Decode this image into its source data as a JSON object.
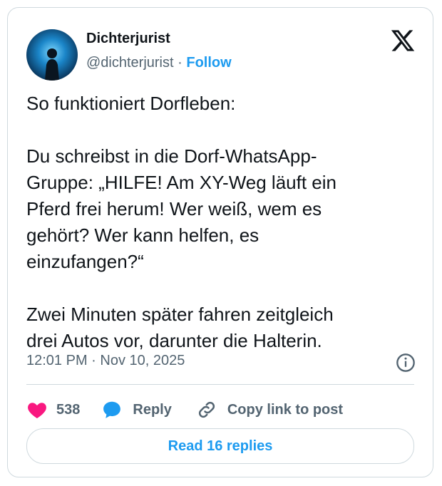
{
  "author": {
    "display_name": "Dichterjurist",
    "handle": "@dichterjurist",
    "separator": "·",
    "follow_label": "Follow"
  },
  "post": {
    "text": "So funktioniert Dorfleben:\n\nDu schreibst in die Dorf-WhatsApp-\nGruppe: „HILFE! Am XY-Weg läuft ein\nPferd frei herum! Wer weiß, wem es\ngehört? Wer kann helfen, es\neinzufangen?“\n\nZwei Minuten später fahren zeitgleich\ndrei Autos vor, darunter die Halterin.",
    "timestamp": "12:01 PM · Nov 10, 2025"
  },
  "actions": {
    "likes_count": "538",
    "reply_label": "Reply",
    "copy_link_label": "Copy link to post"
  },
  "read_replies_label": "Read 16 replies",
  "colors": {
    "accent": "#1d9bf0",
    "like": "#f91880",
    "muted": "#536471",
    "border": "#cfd9de"
  },
  "icons": [
    "x-logo-icon",
    "info-icon",
    "heart-icon",
    "reply-bubble-icon",
    "link-icon"
  ]
}
